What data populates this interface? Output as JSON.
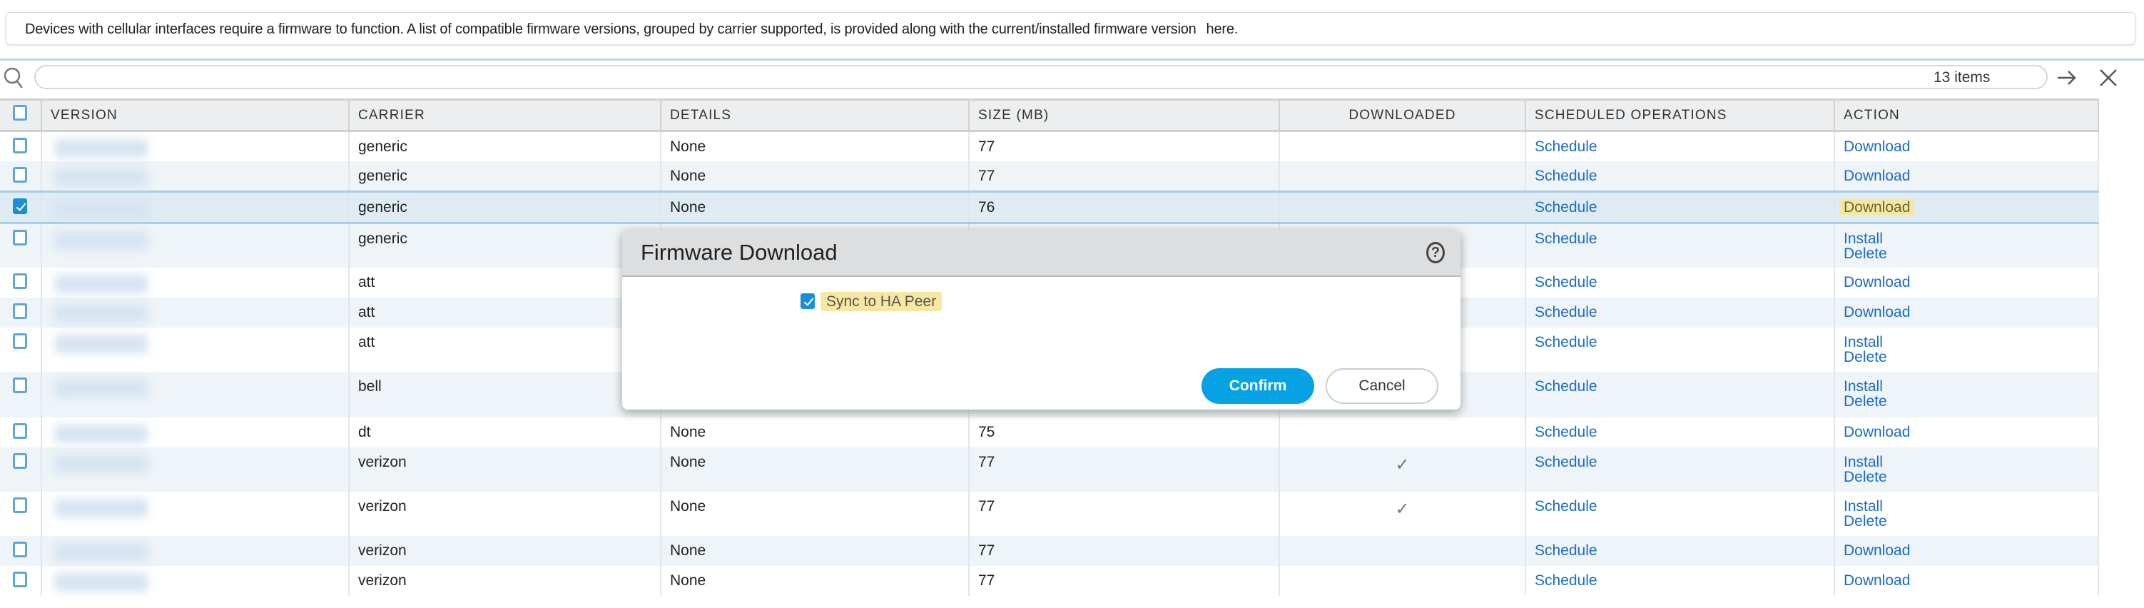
{
  "notice": {
    "text": "Devices with cellular interfaces require a firmware to function. A list of compatible firmware versions, grouped by carrier supported, is provided along with the current/installed firmware version",
    "link": "here."
  },
  "toolbar": {
    "search_value": "",
    "item_count": "13 items"
  },
  "table": {
    "headers": [
      "VERSION",
      "CARRIER",
      "DETAILS",
      "SIZE (MB)",
      "DOWNLOADED",
      "SCHEDULED OPERATIONS",
      "ACTION"
    ],
    "rows": [
      {
        "carrier": "generic",
        "details": "None",
        "size": "77",
        "downloaded": "",
        "schedule": "Schedule",
        "actions": [
          "Download"
        ],
        "checked": false
      },
      {
        "carrier": "generic",
        "details": "None",
        "size": "77",
        "downloaded": "",
        "schedule": "Schedule",
        "actions": [
          "Download"
        ],
        "checked": false
      },
      {
        "carrier": "generic",
        "details": "None",
        "size": "76",
        "downloaded": "",
        "schedule": "Schedule",
        "actions": [
          "Download"
        ],
        "checked": true
      },
      {
        "carrier": "generic",
        "details": "",
        "size": "",
        "downloaded": "",
        "schedule": "Schedule",
        "actions": [
          "Install",
          "Delete"
        ],
        "checked": false
      },
      {
        "carrier": "att",
        "details": "",
        "size": "",
        "downloaded": "",
        "schedule": "Schedule",
        "actions": [
          "Download"
        ],
        "checked": false
      },
      {
        "carrier": "att",
        "details": "",
        "size": "",
        "downloaded": "",
        "schedule": "Schedule",
        "actions": [
          "Download"
        ],
        "checked": false
      },
      {
        "carrier": "att",
        "details": "",
        "size": "",
        "downloaded": "",
        "schedule": "Schedule",
        "actions": [
          "Install",
          "Delete"
        ],
        "checked": false
      },
      {
        "carrier": "bell",
        "details": "",
        "size": "",
        "downloaded": "",
        "schedule": "Schedule",
        "actions": [
          "Install",
          "Delete"
        ],
        "checked": false
      },
      {
        "carrier": "dt",
        "details": "None",
        "size": "75",
        "downloaded": "",
        "schedule": "Schedule",
        "actions": [
          "Download"
        ],
        "checked": false
      },
      {
        "carrier": "verizon",
        "details": "None",
        "size": "77",
        "downloaded": "✓",
        "schedule": "Schedule",
        "actions": [
          "Install",
          "Delete"
        ],
        "checked": false
      },
      {
        "carrier": "verizon",
        "details": "None",
        "size": "77",
        "downloaded": "✓",
        "schedule": "Schedule",
        "actions": [
          "Install",
          "Delete"
        ],
        "checked": false
      },
      {
        "carrier": "verizon",
        "details": "None",
        "size": "77",
        "downloaded": "",
        "schedule": "Schedule",
        "actions": [
          "Download"
        ],
        "checked": false
      },
      {
        "carrier": "verizon",
        "details": "None",
        "size": "77",
        "downloaded": "",
        "schedule": "Schedule",
        "actions": [
          "Download"
        ],
        "checked": false
      }
    ]
  },
  "modal": {
    "title": "Firmware Download",
    "help": "?",
    "sync_label": "Sync to HA Peer",
    "sync_checked": true,
    "confirm": "Confirm",
    "cancel": "Cancel"
  },
  "colors": {
    "accent": "#07a2e4",
    "link": "#1a6cc8",
    "highlight": "#f6e89a"
  }
}
